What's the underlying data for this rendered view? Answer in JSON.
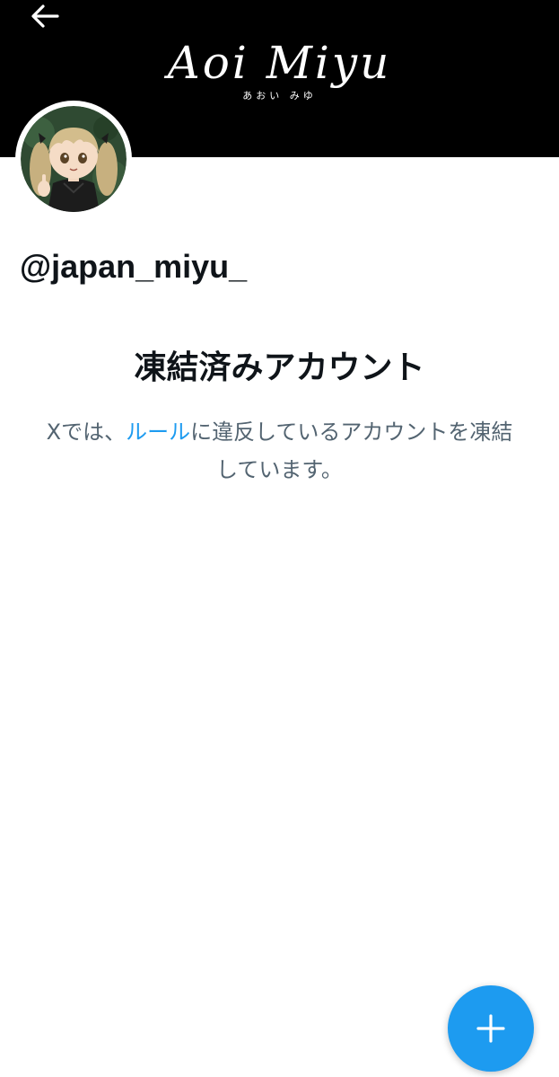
{
  "header": {
    "back_icon": "arrow-left-icon",
    "banner_logo": "Aoi Miyu",
    "banner_logo_sub": "あおい みゆ"
  },
  "profile": {
    "avatar_icon": "avatar",
    "handle": "@japan_miyu_"
  },
  "suspension": {
    "title": "凍結済みアカウント",
    "message_prefix": "Xでは、",
    "rules_link": "ルール",
    "message_suffix": "に違反しているアカウントを凍結しています。"
  },
  "fab": {
    "icon": "plus-icon"
  },
  "colors": {
    "accent": "#1d9bf0",
    "banner_bg": "#000000",
    "text_primary": "#0f1419",
    "text_secondary": "#536471"
  }
}
